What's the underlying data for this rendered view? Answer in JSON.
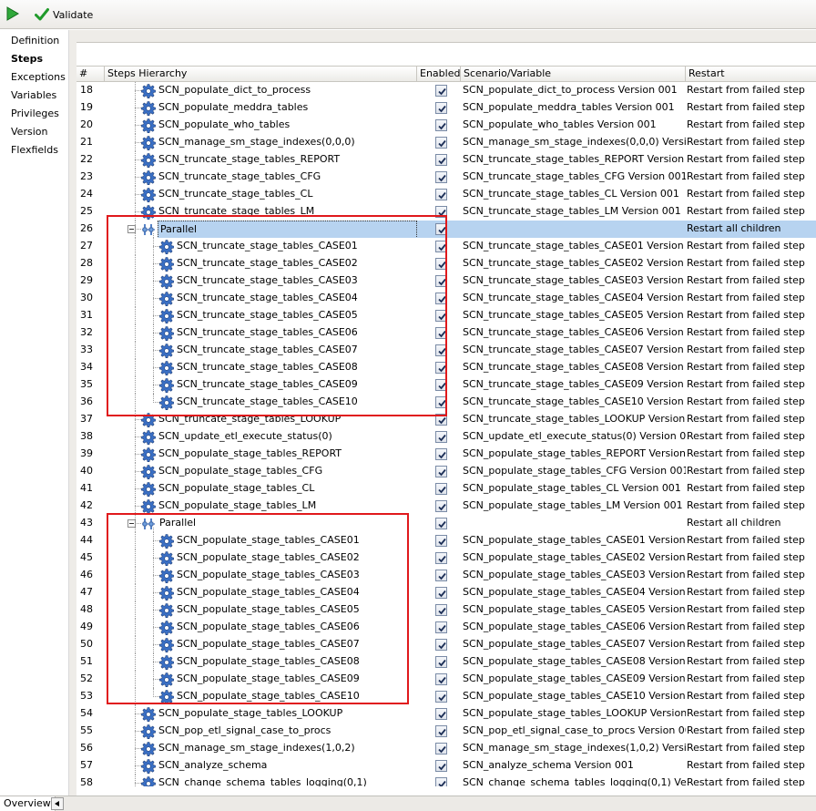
{
  "toolbar": {
    "validate_label": "Validate",
    "run_icon": "run-icon",
    "validate_icon": "check-icon"
  },
  "sidebar": {
    "items": [
      {
        "label": "Definition",
        "active": false
      },
      {
        "label": "Steps",
        "active": true
      },
      {
        "label": "Exceptions",
        "active": false
      },
      {
        "label": "Variables",
        "active": false
      },
      {
        "label": "Privileges",
        "active": false
      },
      {
        "label": "Version",
        "active": false
      },
      {
        "label": "Flexfields",
        "active": false
      }
    ]
  },
  "table": {
    "columns": [
      "#",
      "Steps Hierarchy",
      "Enabled",
      "Scenario/Variable",
      "Restart"
    ],
    "rows": [
      {
        "num": "18",
        "name": "SCN_populate_dict_to_process",
        "level": 1,
        "type": "step",
        "enabled": true,
        "scenario": "SCN_populate_dict_to_process Version 001",
        "restart": "Restart from failed step"
      },
      {
        "num": "19",
        "name": "SCN_populate_meddra_tables",
        "level": 1,
        "type": "step",
        "enabled": true,
        "scenario": "SCN_populate_meddra_tables Version 001",
        "restart": "Restart from failed step"
      },
      {
        "num": "20",
        "name": "SCN_populate_who_tables",
        "level": 1,
        "type": "step",
        "enabled": true,
        "scenario": "SCN_populate_who_tables Version 001",
        "restart": "Restart from failed step"
      },
      {
        "num": "21",
        "name": "SCN_manage_sm_stage_indexes(0,0,0)",
        "level": 1,
        "type": "step",
        "enabled": true,
        "scenario": "SCN_manage_sm_stage_indexes(0,0,0) Version...",
        "restart": "Restart from failed step"
      },
      {
        "num": "22",
        "name": "SCN_truncate_stage_tables_REPORT",
        "level": 1,
        "type": "step",
        "enabled": true,
        "scenario": "SCN_truncate_stage_tables_REPORT Version 001",
        "restart": "Restart from failed step"
      },
      {
        "num": "23",
        "name": "SCN_truncate_stage_tables_CFG",
        "level": 1,
        "type": "step",
        "enabled": true,
        "scenario": "SCN_truncate_stage_tables_CFG Version 001",
        "restart": "Restart from failed step"
      },
      {
        "num": "24",
        "name": "SCN_truncate_stage_tables_CL",
        "level": 1,
        "type": "step",
        "enabled": true,
        "scenario": "SCN_truncate_stage_tables_CL Version 001",
        "restart": "Restart from failed step"
      },
      {
        "num": "25",
        "name": "SCN_truncate_stage_tables_LM",
        "level": 1,
        "type": "step",
        "enabled": true,
        "scenario": "SCN_truncate_stage_tables_LM Version 001",
        "restart": "Restart from failed step"
      },
      {
        "num": "26",
        "name": "Parallel",
        "level": 1,
        "type": "parallel",
        "enabled": true,
        "scenario": "",
        "restart": "Restart all children",
        "selected": true
      },
      {
        "num": "27",
        "name": "SCN_truncate_stage_tables_CASE01",
        "level": 2,
        "type": "step",
        "enabled": true,
        "scenario": "SCN_truncate_stage_tables_CASE01 Version 001",
        "restart": "Restart from failed step"
      },
      {
        "num": "28",
        "name": "SCN_truncate_stage_tables_CASE02",
        "level": 2,
        "type": "step",
        "enabled": true,
        "scenario": "SCN_truncate_stage_tables_CASE02 Version 001",
        "restart": "Restart from failed step"
      },
      {
        "num": "29",
        "name": "SCN_truncate_stage_tables_CASE03",
        "level": 2,
        "type": "step",
        "enabled": true,
        "scenario": "SCN_truncate_stage_tables_CASE03 Version 001",
        "restart": "Restart from failed step"
      },
      {
        "num": "30",
        "name": "SCN_truncate_stage_tables_CASE04",
        "level": 2,
        "type": "step",
        "enabled": true,
        "scenario": "SCN_truncate_stage_tables_CASE04 Version 001",
        "restart": "Restart from failed step"
      },
      {
        "num": "31",
        "name": "SCN_truncate_stage_tables_CASE05",
        "level": 2,
        "type": "step",
        "enabled": true,
        "scenario": "SCN_truncate_stage_tables_CASE05 Version 001",
        "restart": "Restart from failed step"
      },
      {
        "num": "32",
        "name": "SCN_truncate_stage_tables_CASE06",
        "level": 2,
        "type": "step",
        "enabled": true,
        "scenario": "SCN_truncate_stage_tables_CASE06 Version 001",
        "restart": "Restart from failed step"
      },
      {
        "num": "33",
        "name": "SCN_truncate_stage_tables_CASE07",
        "level": 2,
        "type": "step",
        "enabled": true,
        "scenario": "SCN_truncate_stage_tables_CASE07 Version 001",
        "restart": "Restart from failed step"
      },
      {
        "num": "34",
        "name": "SCN_truncate_stage_tables_CASE08",
        "level": 2,
        "type": "step",
        "enabled": true,
        "scenario": "SCN_truncate_stage_tables_CASE08 Version 001",
        "restart": "Restart from failed step"
      },
      {
        "num": "35",
        "name": "SCN_truncate_stage_tables_CASE09",
        "level": 2,
        "type": "step",
        "enabled": true,
        "scenario": "SCN_truncate_stage_tables_CASE09 Version 001",
        "restart": "Restart from failed step"
      },
      {
        "num": "36",
        "name": "SCN_truncate_stage_tables_CASE10",
        "level": 2,
        "type": "step",
        "enabled": true,
        "scenario": "SCN_truncate_stage_tables_CASE10 Version 001",
        "restart": "Restart from failed step"
      },
      {
        "num": "37",
        "name": "SCN_truncate_stage_tables_LOOKUP",
        "level": 1,
        "type": "step",
        "enabled": true,
        "scenario": "SCN_truncate_stage_tables_LOOKUP Version 001",
        "restart": "Restart from failed step"
      },
      {
        "num": "38",
        "name": "SCN_update_etl_execute_status(0)",
        "level": 1,
        "type": "step",
        "enabled": true,
        "scenario": "SCN_update_etl_execute_status(0) Version 001",
        "restart": "Restart from failed step"
      },
      {
        "num": "39",
        "name": "SCN_populate_stage_tables_REPORT",
        "level": 1,
        "type": "step",
        "enabled": true,
        "scenario": "SCN_populate_stage_tables_REPORT Version 001",
        "restart": "Restart from failed step"
      },
      {
        "num": "40",
        "name": "SCN_populate_stage_tables_CFG",
        "level": 1,
        "type": "step",
        "enabled": true,
        "scenario": "SCN_populate_stage_tables_CFG Version 001",
        "restart": "Restart from failed step"
      },
      {
        "num": "41",
        "name": "SCN_populate_stage_tables_CL",
        "level": 1,
        "type": "step",
        "enabled": true,
        "scenario": "SCN_populate_stage_tables_CL Version 001",
        "restart": "Restart from failed step"
      },
      {
        "num": "42",
        "name": "SCN_populate_stage_tables_LM",
        "level": 1,
        "type": "step",
        "enabled": true,
        "scenario": "SCN_populate_stage_tables_LM Version 001",
        "restart": "Restart from failed step"
      },
      {
        "num": "43",
        "name": "Parallel",
        "level": 1,
        "type": "parallel",
        "enabled": true,
        "scenario": "",
        "restart": "Restart all children"
      },
      {
        "num": "44",
        "name": "SCN_populate_stage_tables_CASE01",
        "level": 2,
        "type": "step",
        "enabled": true,
        "scenario": "SCN_populate_stage_tables_CASE01 Version 001",
        "restart": "Restart from failed step"
      },
      {
        "num": "45",
        "name": "SCN_populate_stage_tables_CASE02",
        "level": 2,
        "type": "step",
        "enabled": true,
        "scenario": "SCN_populate_stage_tables_CASE02 Version 001",
        "restart": "Restart from failed step"
      },
      {
        "num": "46",
        "name": "SCN_populate_stage_tables_CASE03",
        "level": 2,
        "type": "step",
        "enabled": true,
        "scenario": "SCN_populate_stage_tables_CASE03 Version 001",
        "restart": "Restart from failed step"
      },
      {
        "num": "47",
        "name": "SCN_populate_stage_tables_CASE04",
        "level": 2,
        "type": "step",
        "enabled": true,
        "scenario": "SCN_populate_stage_tables_CASE04 Version 001",
        "restart": "Restart from failed step"
      },
      {
        "num": "48",
        "name": "SCN_populate_stage_tables_CASE05",
        "level": 2,
        "type": "step",
        "enabled": true,
        "scenario": "SCN_populate_stage_tables_CASE05 Version 001",
        "restart": "Restart from failed step"
      },
      {
        "num": "49",
        "name": "SCN_populate_stage_tables_CASE06",
        "level": 2,
        "type": "step",
        "enabled": true,
        "scenario": "SCN_populate_stage_tables_CASE06 Version 001",
        "restart": "Restart from failed step"
      },
      {
        "num": "50",
        "name": "SCN_populate_stage_tables_CASE07",
        "level": 2,
        "type": "step",
        "enabled": true,
        "scenario": "SCN_populate_stage_tables_CASE07 Version 001",
        "restart": "Restart from failed step"
      },
      {
        "num": "51",
        "name": "SCN_populate_stage_tables_CASE08",
        "level": 2,
        "type": "step",
        "enabled": true,
        "scenario": "SCN_populate_stage_tables_CASE08 Version 001",
        "restart": "Restart from failed step"
      },
      {
        "num": "52",
        "name": "SCN_populate_stage_tables_CASE09",
        "level": 2,
        "type": "step",
        "enabled": true,
        "scenario": "SCN_populate_stage_tables_CASE09 Version 001",
        "restart": "Restart from failed step"
      },
      {
        "num": "53",
        "name": "SCN_populate_stage_tables_CASE10",
        "level": 2,
        "type": "step",
        "enabled": true,
        "scenario": "SCN_populate_stage_tables_CASE10 Version 001",
        "restart": "Restart from failed step"
      },
      {
        "num": "54",
        "name": "SCN_populate_stage_tables_LOOKUP",
        "level": 1,
        "type": "step",
        "enabled": true,
        "scenario": "SCN_populate_stage_tables_LOOKUP Version 001",
        "restart": "Restart from failed step"
      },
      {
        "num": "55",
        "name": "SCN_pop_etl_signal_case_to_procs",
        "level": 1,
        "type": "step",
        "enabled": true,
        "scenario": "SCN_pop_etl_signal_case_to_procs Version 001",
        "restart": "Restart from failed step"
      },
      {
        "num": "56",
        "name": "SCN_manage_sm_stage_indexes(1,0,2)",
        "level": 1,
        "type": "step",
        "enabled": true,
        "scenario": "SCN_manage_sm_stage_indexes(1,0,2) Version...",
        "restart": "Restart from failed step"
      },
      {
        "num": "57",
        "name": "SCN_analyze_schema",
        "level": 1,
        "type": "step",
        "enabled": true,
        "scenario": "SCN_analyze_schema Version 001",
        "restart": "Restart from failed step"
      },
      {
        "num": "58",
        "name": "SCN_change_schema_tables_logging(0,1)",
        "level": 1,
        "type": "step",
        "enabled": true,
        "scenario": "SCN_change_schema_tables_logging(0,1) Versi...",
        "restart": "Restart from failed step"
      }
    ]
  },
  "bottom": {
    "overview_label": "Overview"
  },
  "colors": {
    "selection": "#b7d3f0",
    "highlight_box": "#e0191c",
    "gear": "#3a6fc4"
  }
}
